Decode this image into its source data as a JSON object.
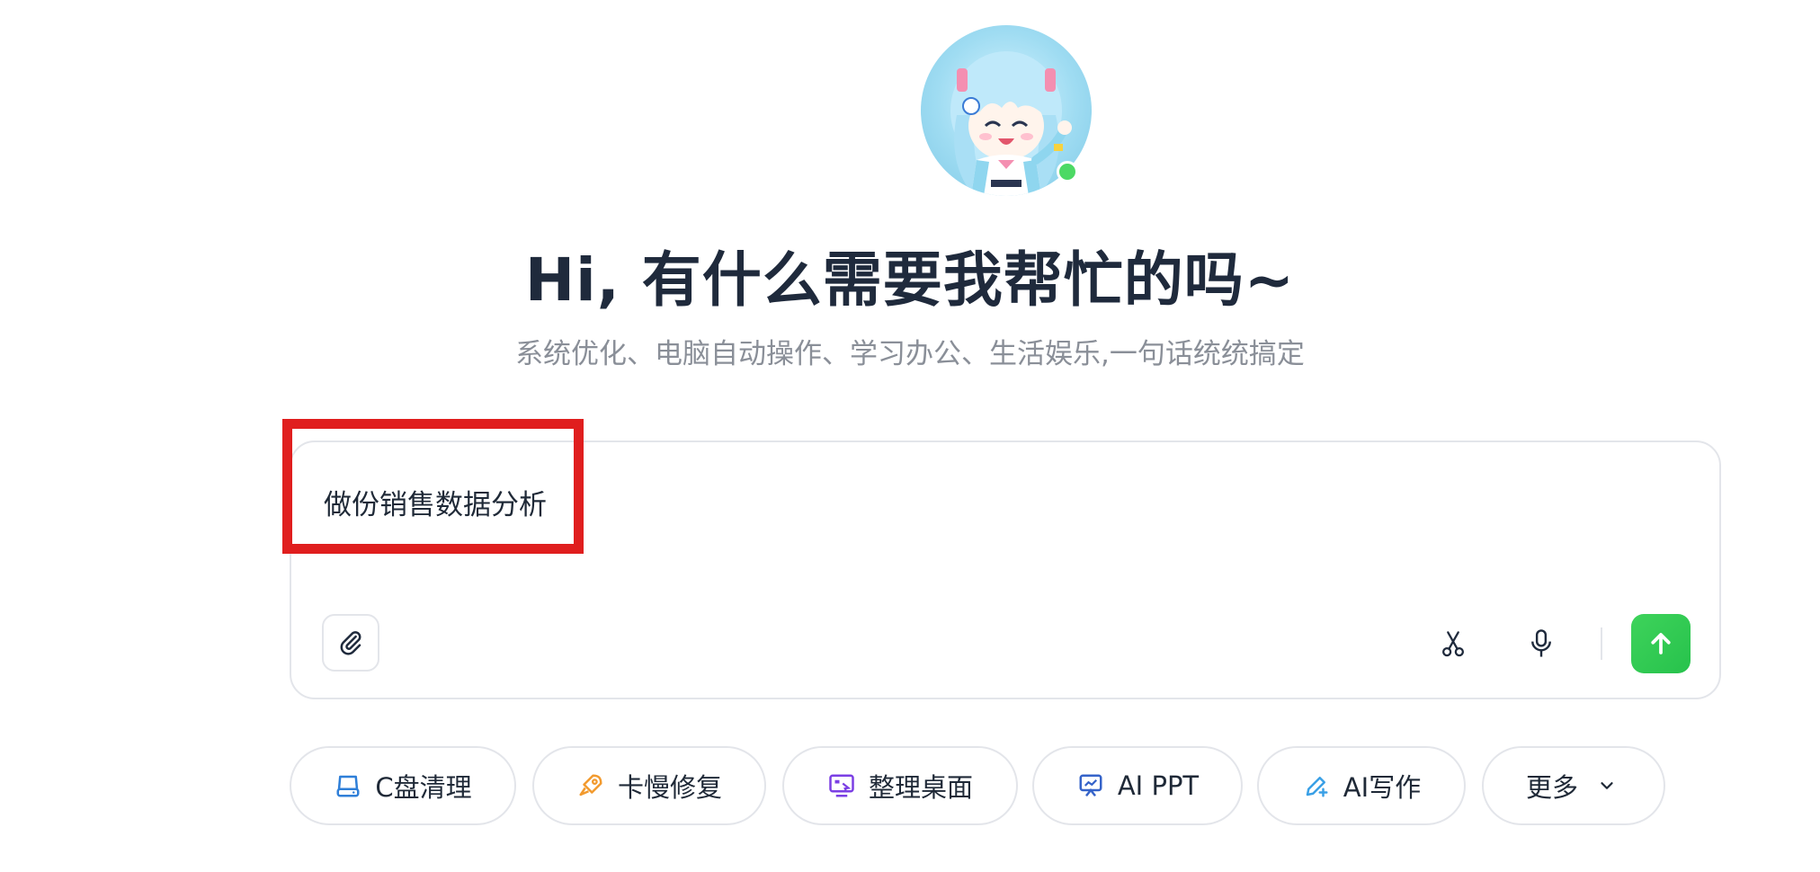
{
  "header": {
    "title": "Hi, 有什么需要我帮忙的吗~",
    "subtitle": "系统优化、电脑自动操作、学习办公、生活娱乐,一句话统统搞定",
    "avatar_status": "online"
  },
  "input": {
    "value": "做份销售数据分析",
    "send_icon": "arrow-up-icon",
    "attach_icon": "paperclip-icon",
    "scissors_icon": "scissors-icon",
    "mic_icon": "microphone-icon"
  },
  "chips": [
    {
      "label": "C盘清理",
      "icon": "drive-icon",
      "color": "#2f7fd8"
    },
    {
      "label": "卡慢修复",
      "icon": "rocket-icon",
      "color": "#f29a2e"
    },
    {
      "label": "整理桌面",
      "icon": "desktop-icon",
      "color": "#7b3fe4"
    },
    {
      "label": "AI PPT",
      "icon": "presentation-icon",
      "color": "#3563c9"
    },
    {
      "label": "AI写作",
      "icon": "pen-icon",
      "color": "#3aa0e6"
    },
    {
      "label": "更多",
      "icon": "chevron-down-icon",
      "color": "#1f2937"
    }
  ],
  "colors": {
    "accent_green": "#2fca52",
    "highlight_red": "#e01e1e",
    "online_green": "#4cd964"
  }
}
